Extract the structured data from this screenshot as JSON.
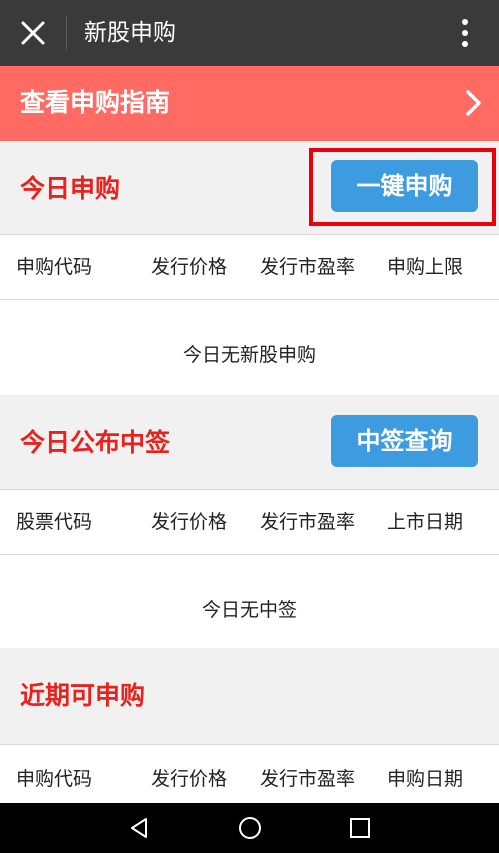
{
  "header": {
    "title": "新股申购",
    "close_icon": "close-icon",
    "more_icon": "more-vertical-icon"
  },
  "guide_banner": {
    "label": "查看申购指南",
    "icon": "chevron-right-icon",
    "color": "#ff6b63"
  },
  "today_subscribe": {
    "title": "今日申购",
    "button": "一键申购",
    "columns": [
      "申购代码",
      "发行价格",
      "发行市盈率",
      "申购上限"
    ],
    "empty_text": "今日无新股申购"
  },
  "today_winning": {
    "title": "今日公布中签",
    "button": "中签查询",
    "columns": [
      "股票代码",
      "发行价格",
      "发行市盈率",
      "上市日期"
    ],
    "empty_text": "今日无中签"
  },
  "upcoming": {
    "title": "近期可申购",
    "columns": [
      "申购代码",
      "发行价格",
      "发行市盈率",
      "申购日期"
    ]
  },
  "nav_bar": {
    "back_icon": "back-triangle-icon",
    "home_icon": "home-circle-icon",
    "recents_icon": "recents-square-icon"
  },
  "colors": {
    "accent_red": "#e8231e",
    "button_blue": "#3d9be0",
    "titlebar": "#3a3a3a"
  }
}
